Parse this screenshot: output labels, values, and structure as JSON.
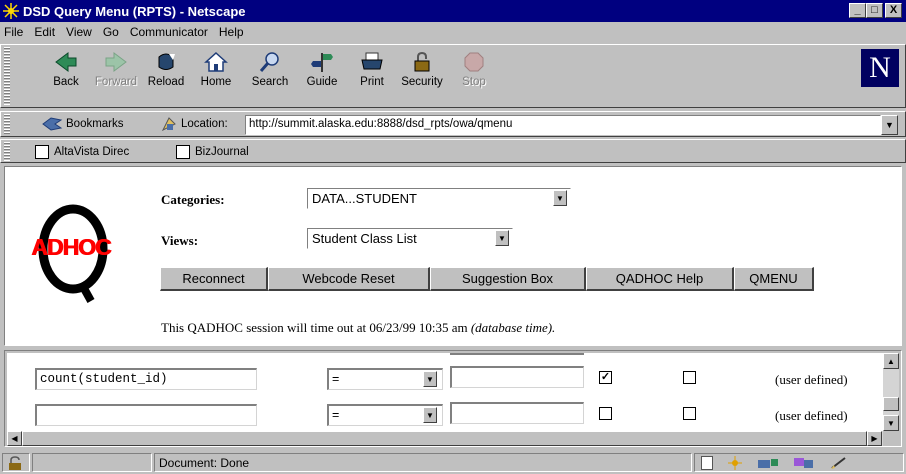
{
  "window": {
    "title": "DSD Query Menu (RPTS) - Netscape",
    "controls": [
      "_",
      "□",
      "X"
    ]
  },
  "menu": {
    "items": [
      {
        "label": "File",
        "hotkey": "F"
      },
      {
        "label": "Edit",
        "hotkey": "E"
      },
      {
        "label": "View",
        "hotkey": "V"
      },
      {
        "label": "Go",
        "hotkey": "G"
      },
      {
        "label": "Communicator",
        "hotkey": "C"
      },
      {
        "label": "Help",
        "hotkey": "H"
      }
    ]
  },
  "toolbar": {
    "buttons": [
      {
        "label": "Back",
        "icon": "back-arrow-icon",
        "enabled": true
      },
      {
        "label": "Forward",
        "icon": "forward-arrow-icon",
        "enabled": false
      },
      {
        "label": "Reload",
        "icon": "reload-icon",
        "enabled": true
      },
      {
        "label": "Home",
        "icon": "home-icon",
        "enabled": true
      },
      {
        "label": "Search",
        "icon": "search-icon",
        "enabled": true
      },
      {
        "label": "Guide",
        "icon": "guide-icon",
        "enabled": true
      },
      {
        "label": "Print",
        "icon": "print-icon",
        "enabled": true
      },
      {
        "label": "Security",
        "icon": "lock-icon",
        "enabled": true
      },
      {
        "label": "Stop",
        "icon": "stop-icon",
        "enabled": false
      }
    ],
    "logo_letter": "N"
  },
  "location": {
    "bookmarks_label": "Bookmarks",
    "location_label": "Location:",
    "url": "http://summit.alaska.edu:8888/dsd_rpts/owa/qmenu"
  },
  "personal": {
    "items": [
      "AltaVista Direc",
      "BizJournal"
    ]
  },
  "page": {
    "logo_text": "ADHOC",
    "categories_label": "Categories:",
    "categories_value": "DATA...STUDENT",
    "views_label": "Views:",
    "views_value": "Student Class List",
    "nav_buttons": [
      "Reconnect",
      "Webcode Reset",
      "Suggestion Box",
      "QADHOC Help",
      "QMENU"
    ],
    "timeout_text": "This QADHOC session will time out at 06/23/99 10:35 am",
    "timeout_note": "(database time)."
  },
  "query_rows": [
    {
      "field": "count(student_id)",
      "operator": "=",
      "value": "",
      "check1": true,
      "check2": false,
      "note": "(user defined)"
    },
    {
      "field": "",
      "operator": "=",
      "value": "",
      "check1": false,
      "check2": false,
      "note": "(user defined)"
    }
  ],
  "status": {
    "text": "Document: Done"
  },
  "colors": {
    "titlebar": "#000080",
    "logo_q": "#000000",
    "logo_adhoc": "#ff0000"
  }
}
